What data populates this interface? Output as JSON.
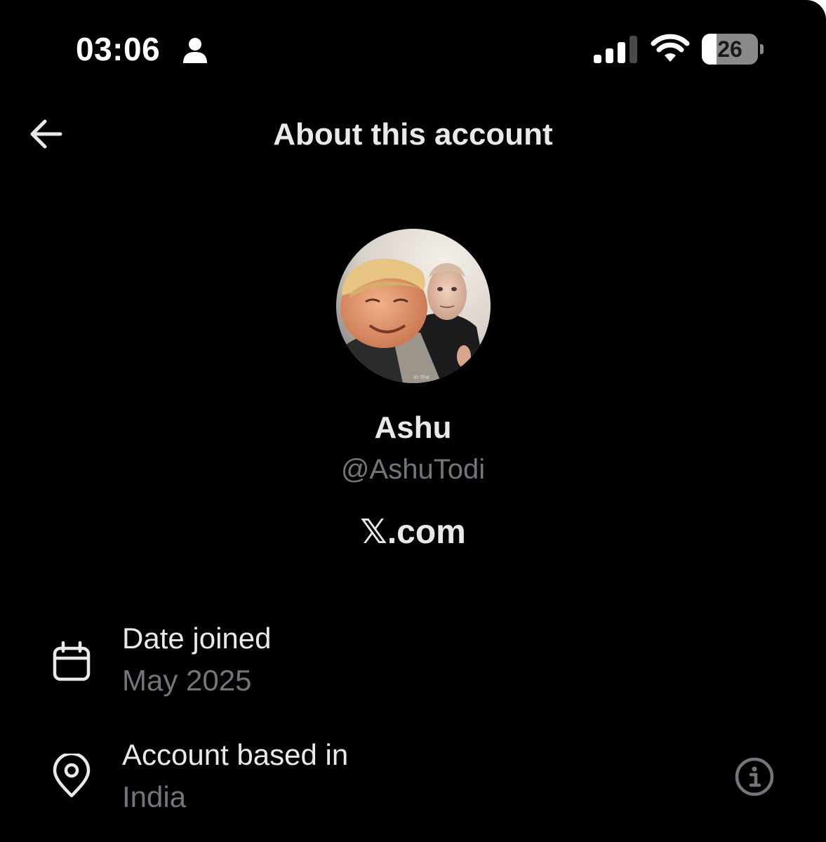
{
  "status_bar": {
    "time": "03:06",
    "person_icon": "person-icon",
    "signal_icon": "cellular-signal-icon",
    "signal_bars_filled": 3,
    "signal_bars_total": 4,
    "wifi_icon": "wifi-icon",
    "battery_icon": "battery-icon",
    "battery_level": "26",
    "battery_fraction": 0.26
  },
  "header": {
    "back_icon": "arrow-left-icon",
    "title": "About this account"
  },
  "profile": {
    "avatar": "profile-photo",
    "name": "Ashu",
    "handle": "@AshuTodi",
    "website": "𝕏.com"
  },
  "details": [
    {
      "icon": "calendar-icon",
      "label": "Date joined",
      "value": "May 2025"
    },
    {
      "icon": "location-pin-icon",
      "label": "Account based in",
      "value": "India",
      "info_icon": "info-icon"
    }
  ],
  "colors": {
    "background": "#000000",
    "primary_text": "#e7e9ea",
    "secondary_text": "#71767b",
    "icon": "#e7e9ea",
    "info_icon": "#71767b"
  }
}
